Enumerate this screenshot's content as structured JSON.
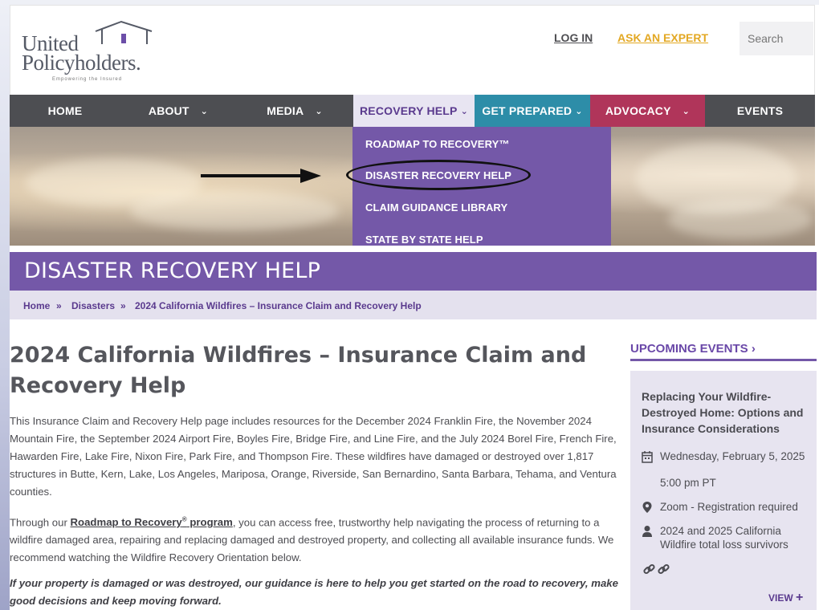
{
  "header": {
    "logo_word1": "United",
    "logo_word2": "Policyholders.",
    "logo_tagline": "Empowering the Insured",
    "login_label": "LOG IN",
    "ask_label": "ASK AN EXPERT",
    "search_placeholder": "Search"
  },
  "nav": {
    "items": [
      {
        "label": "HOME"
      },
      {
        "label": "ABOUT"
      },
      {
        "label": "MEDIA"
      },
      {
        "label": "RECOVERY HELP"
      },
      {
        "label": "GET PREPARED"
      },
      {
        "label": "ADVOCACY"
      },
      {
        "label": "EVENTS"
      }
    ],
    "chevron": "⌄"
  },
  "dropdown": {
    "items": [
      {
        "label": "ROADMAP TO RECOVERY™"
      },
      {
        "label": "DISASTER RECOVERY HELP"
      },
      {
        "label": "CLAIM GUIDANCE LIBRARY"
      },
      {
        "label": "STATE BY STATE HELP"
      }
    ]
  },
  "banner": {
    "title": "DISASTER RECOVERY HELP"
  },
  "breadcrumb": {
    "items": [
      "Home",
      "Disasters",
      "2024 California Wildfires – Insurance Claim and Recovery Help"
    ],
    "separator": "»"
  },
  "article": {
    "title": "2024 California Wildfires – Insurance Claim and Recovery Help",
    "para1": "This Insurance Claim and Recovery Help page includes resources for the December 2024 Franklin Fire, the November 2024 Mountain Fire, the September 2024 Airport Fire, Boyles Fire, Bridge Fire, and Line Fire, and the July 2024 Borel Fire, French Fire, Hawarden Fire, Lake Fire, Nixon Fire, Park Fire, and Thompson Fire. These wildfires have damaged or destroyed over 1,817 structures in Butte, Kern, Lake, Los Angeles, Mariposa, Orange, Riverside, San Bernardino, Santa Barbara, Tehama, and Ventura counties.",
    "para2_prefix": "Through our ",
    "para2_link": "Roadmap to Recovery",
    "para2_reg": "®",
    "para2_link2": " program",
    "para2_suffix": ", you can access free, trustworthy help navigating the process of returning to a wildfire damaged area, repairing and replacing damaged and destroyed property, and collecting all available insurance funds. We recommend watching the Wildfire Recovery Orientation below.",
    "para3": "If your property is damaged or was destroyed, our guidance is here to help you get started on the road to recovery, make good decisions and keep moving forward."
  },
  "sidebar": {
    "heading": "UPCOMING EVENTS",
    "heading_chevron": "›",
    "event": {
      "title": "Replacing Your Wildfire-Destroyed Home: Options and Insurance Considerations",
      "date": "Wednesday, February 5, 2025",
      "time": "5:00 pm PT",
      "location": "Zoom - Registration required",
      "audience": "2024 and 2025 California Wildfire total loss survivors",
      "links": "🔗 🔗",
      "view_label": "VIEW",
      "view_plus": "+"
    }
  },
  "colors": {
    "purple": "#7458a8",
    "nav_dark": "#4d4e52",
    "prepared_teal": "#2d8da8",
    "advocacy_red": "#b0355a",
    "ask_orange": "#e3a823"
  }
}
